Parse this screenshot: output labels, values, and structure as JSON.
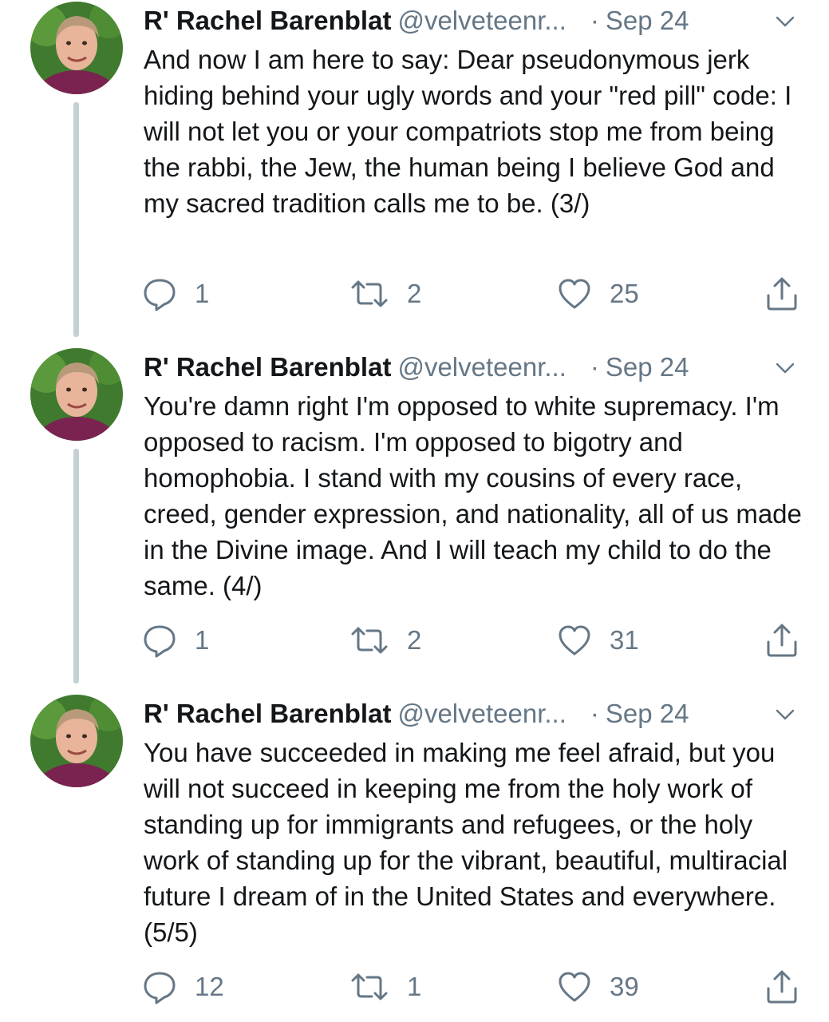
{
  "colors": {
    "text": "#14171a",
    "muted": "#657786",
    "thread_line": "#c4cfd6"
  },
  "tweets": [
    {
      "name": "R' Rachel Barenblat",
      "handle": "@velveteenr...",
      "separator": "·",
      "date": "Sep 24",
      "text": "And now I am here to say: Dear pseudonymous jerk hiding behind your ugly words and your \"red pill\" code: I will not let you or your compatriots stop me from being the rabbi, the Jew, the human being I believe God and my sacred tradition calls me to be. (3/)",
      "replies": "1",
      "retweets": "2",
      "likes": "25"
    },
    {
      "name": "R' Rachel Barenblat",
      "handle": "@velveteenr...",
      "separator": "·",
      "date": "Sep 24",
      "text": "You're damn right I'm opposed to white supremacy. I'm opposed to racism. I'm opposed to bigotry and homophobia. I stand with my cousins of every race, creed, gender expression, and nationality, all of us made in the Divine image. And I will teach my child to do the same. (4/)",
      "replies": "1",
      "retweets": "2",
      "likes": "31"
    },
    {
      "name": "R' Rachel Barenblat",
      "handle": "@velveteenr...",
      "separator": "·",
      "date": "Sep 24",
      "text": "You have succeeded in making me feel afraid, but you will not succeed in keeping me from the holy work of standing up for immigrants and refugees, or the holy work of standing up for the vibrant, beautiful, multiracial future I dream of in the United States and everywhere.(5/5)",
      "replies": "12",
      "retweets": "1",
      "likes": "39"
    }
  ]
}
